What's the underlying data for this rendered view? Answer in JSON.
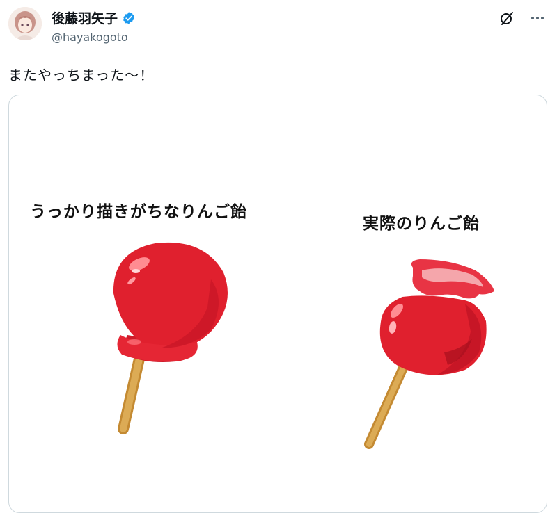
{
  "author": {
    "display_name": "後藤羽矢子",
    "handle": "@hayakogoto",
    "verified": true,
    "avatar_icon": "avatar-icon"
  },
  "actions": {
    "grok_icon": "grok-icon",
    "more_icon": "more-icon",
    "more_label": "···"
  },
  "tweet": {
    "text": "またやっちまった～！"
  },
  "media": {
    "caption_left": "うっかり描きがちなりんご飴",
    "caption_right": "実際のりんご飴"
  },
  "colors": {
    "verified": "#1d9bf0",
    "candy_red": "#e0202e",
    "stick": "#d9a54a",
    "border": "#cfd9de"
  }
}
